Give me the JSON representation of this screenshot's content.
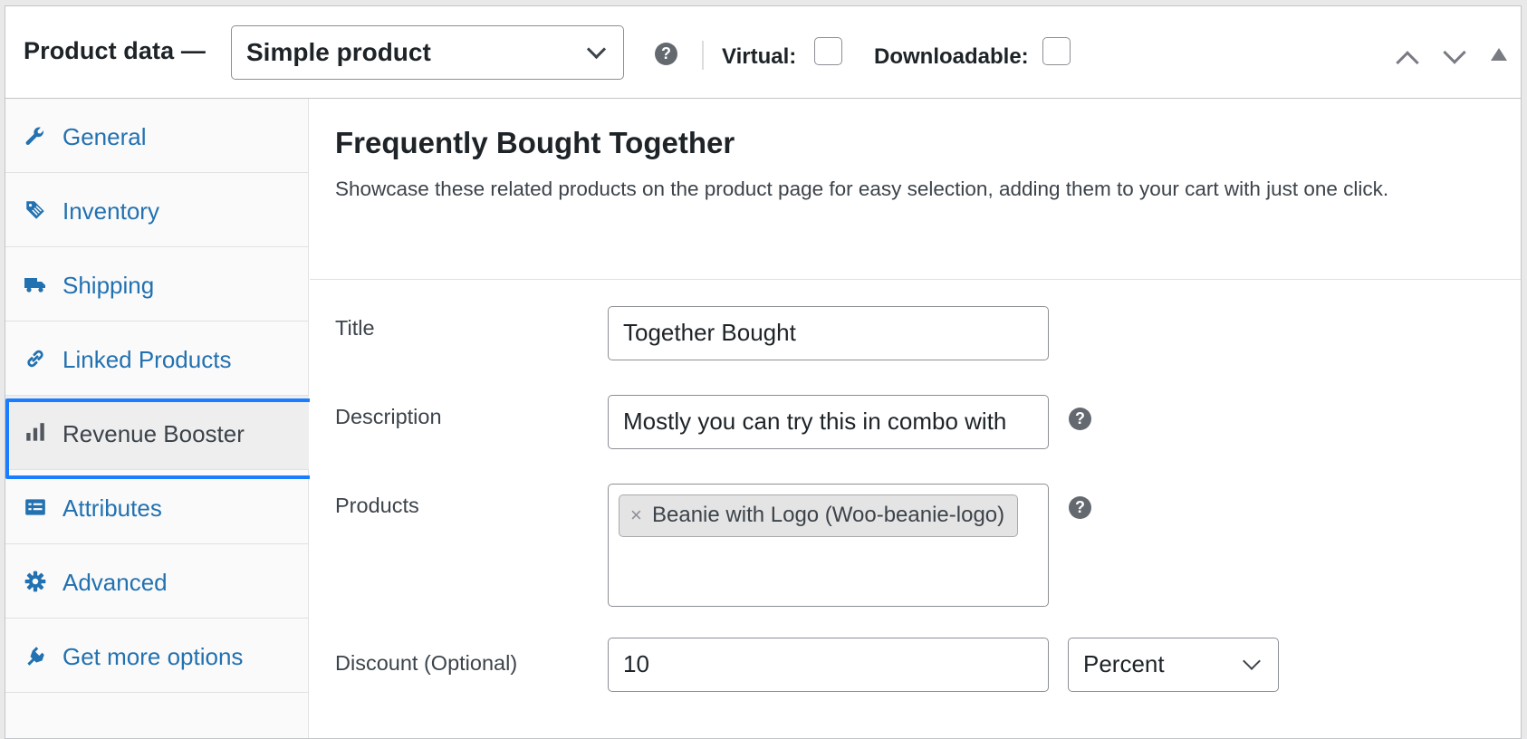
{
  "header": {
    "title": "Product data —",
    "product_type": "Simple product",
    "help": "?",
    "virtual_label": "Virtual:",
    "downloadable_label": "Downloadable:"
  },
  "sidebar": {
    "items": [
      {
        "label": "General",
        "icon": "wrench-icon"
      },
      {
        "label": "Inventory",
        "icon": "tag-icon"
      },
      {
        "label": "Shipping",
        "icon": "truck-icon"
      },
      {
        "label": "Linked Products",
        "icon": "link-icon"
      },
      {
        "label": "Revenue Booster",
        "icon": "bar-chart-icon",
        "active": true
      },
      {
        "label": "Attributes",
        "icon": "list-icon"
      },
      {
        "label": "Advanced",
        "icon": "gear-icon"
      },
      {
        "label": "Get more options",
        "icon": "plugin-icon"
      }
    ]
  },
  "section": {
    "title": "Frequently Bought Together",
    "description": "Showcase these related products on the product page for easy selection, adding them to your cart with just one click."
  },
  "form": {
    "title_label": "Title",
    "title_value": "Together Bought",
    "description_label": "Description",
    "description_value": "Mostly you can try this in combo with",
    "products_label": "Products",
    "products": [
      "Beanie with Logo (Woo-beanie-logo)"
    ],
    "remove_symbol": "×",
    "discount_label": "Discount (Optional)",
    "discount_value": "10",
    "discount_type": "Percent",
    "help": "?"
  },
  "colors": {
    "link": "#2271b1",
    "active_outline": "#1a7dff",
    "help_icon": "#646970"
  }
}
